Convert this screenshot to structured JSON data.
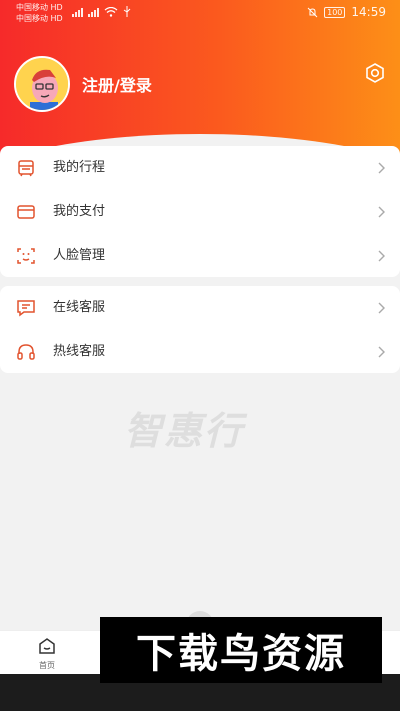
{
  "status_bar": {
    "carrier1": "中国移动 HD",
    "carrier2": "中国移动 HD",
    "battery": "100",
    "time": "14:59"
  },
  "profile": {
    "login_label": "注册/登录"
  },
  "menu_group_1": [
    {
      "label": "我的行程",
      "icon": "itinerary-icon"
    },
    {
      "label": "我的支付",
      "icon": "payment-card-icon"
    },
    {
      "label": "人脸管理",
      "icon": "face-scan-icon"
    }
  ],
  "menu_group_2": [
    {
      "label": "在线客服",
      "icon": "chat-message-icon"
    },
    {
      "label": "热线客服",
      "icon": "headset-icon"
    }
  ],
  "watermark": "智惠行",
  "bottom_nav": {
    "home_label": "首页"
  },
  "overlay_text": "下载鸟资源",
  "colors": {
    "header_start": "#f62a2a",
    "header_end": "#fd8f17",
    "icon_accent": "#e2532e"
  }
}
